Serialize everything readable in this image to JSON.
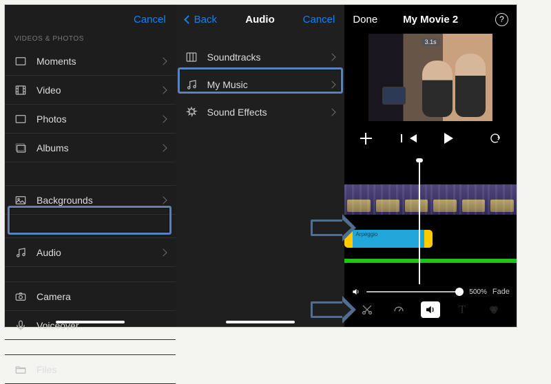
{
  "panel1": {
    "cancel": "Cancel",
    "section_header": "VIDEOS & PHOTOS",
    "rows": {
      "moments": "Moments",
      "video": "Video",
      "photos": "Photos",
      "albums": "Albums",
      "backgrounds": "Backgrounds",
      "audio": "Audio",
      "camera": "Camera",
      "voiceover": "Voiceover",
      "files": "Files"
    }
  },
  "panel2": {
    "back": "Back",
    "title": "Audio",
    "cancel": "Cancel",
    "rows": {
      "soundtracks": "Soundtracks",
      "mymusic": "My Music",
      "soundfx": "Sound Effects"
    }
  },
  "panel3": {
    "done": "Done",
    "title": "My Movie 2",
    "preview_duration": "3.1s",
    "audio_clip_label": "Arpeggio",
    "volume_percent": "500%",
    "fade_label": "Fade",
    "tool_text": "T"
  },
  "highlights": {
    "panel1_audio": true,
    "panel2_mymusic": true
  }
}
